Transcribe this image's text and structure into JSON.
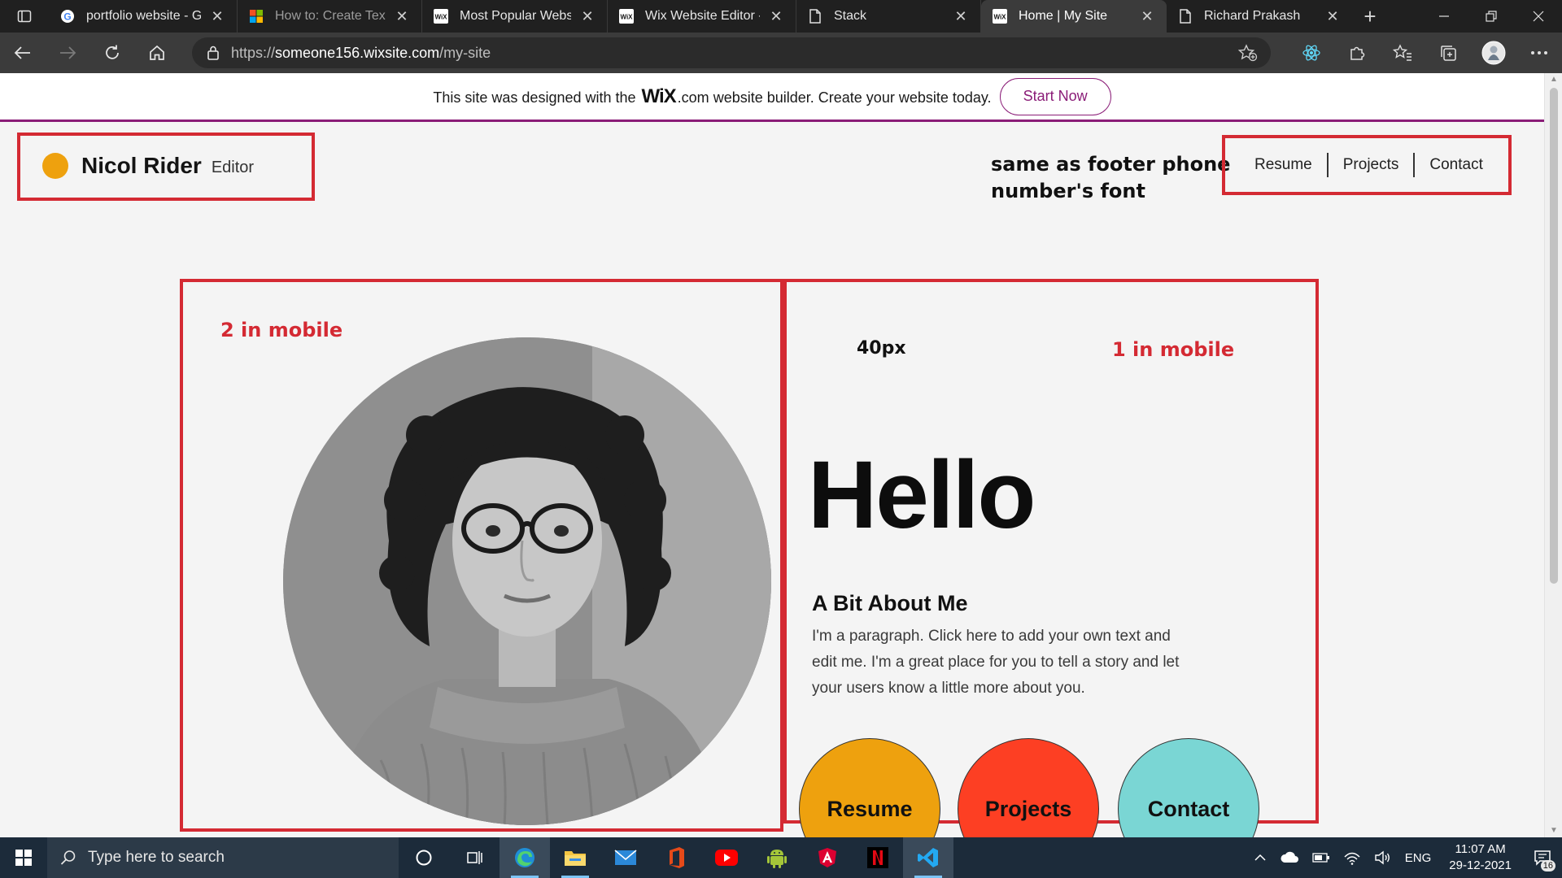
{
  "browser": {
    "tabs": [
      {
        "title": "portfolio website - Go",
        "favicon": "google-icon",
        "dim": false,
        "active": false
      },
      {
        "title": "How to: Create Text w",
        "favicon": "microsoft-icon",
        "dim": true,
        "active": false
      },
      {
        "title": "Most Popular Website",
        "favicon": "wix-icon",
        "dim": false,
        "active": false
      },
      {
        "title": "Wix Website Editor - r",
        "favicon": "wix-icon",
        "dim": false,
        "active": false
      },
      {
        "title": "Stack",
        "favicon": "page-icon",
        "dim": false,
        "active": false
      },
      {
        "title": "Home | My Site",
        "favicon": "wix-icon",
        "dim": false,
        "active": true
      },
      {
        "title": "Richard Prakash",
        "favicon": "page-icon",
        "dim": false,
        "active": false
      }
    ],
    "url_prefix": "https://",
    "url_host": "someone156.wixsite.com",
    "url_path": "/my-site"
  },
  "wix_banner": {
    "text_before": "This site was designed with the",
    "logo": "WiX",
    "logo_suffix": ".com",
    "text_after": "website builder. Create your website today.",
    "button": "Start Now"
  },
  "site": {
    "brand_name": "Nicol Rider",
    "brand_role": "Editor",
    "nav": [
      "Resume",
      "Projects",
      "Contact"
    ],
    "hello": "Hello",
    "about_title": "A Bit About Me",
    "about_text": "I'm a paragraph. Click here to add your own text and edit me. I'm a great place for you to tell a story and let your users know a little more about you.",
    "buttons": {
      "resume": "Resume",
      "projects": "Projects",
      "contact": "Contact"
    }
  },
  "annotations": {
    "font_note": "same as footer phone number's font",
    "left_note": "2 in mobile",
    "size_note": "40px",
    "right_note": "1 in mobile"
  },
  "taskbar": {
    "search_placeholder": "Type here to search",
    "language": "ENG",
    "time": "11:07 AM",
    "date": "29-12-2021",
    "notification_count": "16"
  },
  "colors": {
    "accent_red": "#d42a33",
    "wix_purple": "#8a1c77",
    "resume_orange": "#eea10e",
    "projects_red": "#fd3f23",
    "contact_teal": "#7ad6d4"
  }
}
